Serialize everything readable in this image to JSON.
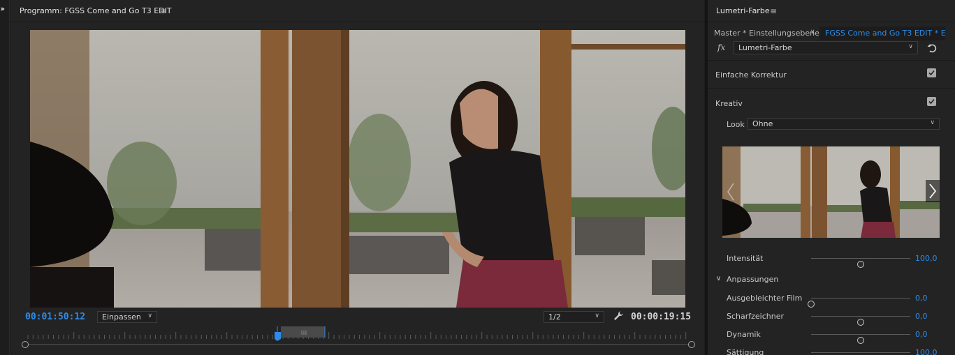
{
  "monitor": {
    "title": "Programm: FGSS Come and Go T3 EDIT",
    "menu_icon": "≡",
    "current_time": "00:01:50:12",
    "fit_label": "Einpassen",
    "resolution_label": "1/2",
    "duration": "00:00:19:15",
    "playhead_color": "#2d8ceb"
  },
  "panel": {
    "title": "Lumetri-Farbe",
    "menu_icon": "≡",
    "master_tab": "Master * Einstellungsebene",
    "clip_tab": "FGSS Come and Go T3 EDIT * E...",
    "fx_label": "fx",
    "effect_name": "Lumetri-Farbe",
    "sections": {
      "basic": {
        "label": "Einfache Korrektur",
        "checked": true
      },
      "creative": {
        "label": "Kreativ",
        "checked": true
      }
    },
    "look_label": "Look",
    "look_value": "Ohne",
    "intensity": {
      "label": "Intensität",
      "value": "100,0",
      "fraction": 0.5
    },
    "adjustments_label": "Anpassungen",
    "adjustments": [
      {
        "label": "Ausgebleichter Film",
        "value": "0,0",
        "fraction": 0.0
      },
      {
        "label": "Scharfzeichner",
        "value": "0,0",
        "fraction": 0.5
      },
      {
        "label": "Dynamik",
        "value": "0,0",
        "fraction": 0.5
      },
      {
        "label": "Sättigung",
        "value": "100,0",
        "fraction": 0.5
      }
    ],
    "accent_color": "#2d8ceb"
  }
}
